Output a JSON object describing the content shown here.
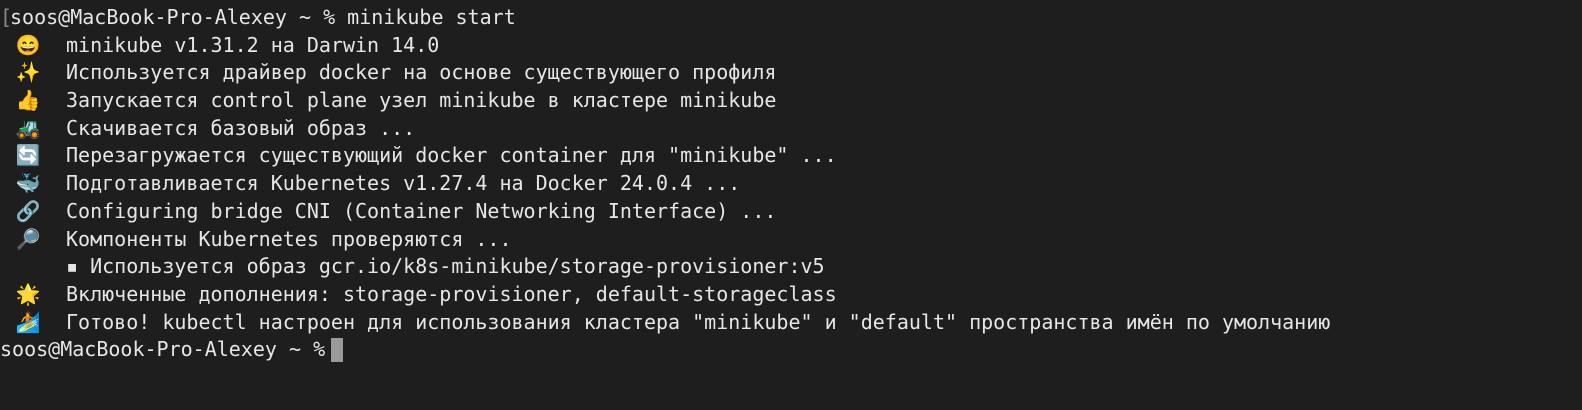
{
  "terminal": {
    "prompt": "soos@MacBook-Pro-Alexey ~ %",
    "command": "minikube start",
    "lines": [
      {
        "icon": "grinning-face-icon",
        "glyph": "😄",
        "text": "minikube v1.31.2 на Darwin 14.0"
      },
      {
        "icon": "sparkles-icon",
        "glyph": "✨",
        "text": "Используется драйвер docker на основе существующего профиля"
      },
      {
        "icon": "thumbs-up-icon",
        "glyph": "👍",
        "text": "Запускается control plane узел minikube в кластере minikube"
      },
      {
        "icon": "tractor-icon",
        "glyph": "🚜",
        "text": "Скачивается базовый образ ..."
      },
      {
        "icon": "arrows-refresh-icon",
        "glyph": "🔄",
        "text": "Перезагружается существующий docker container для \"minikube\" ..."
      },
      {
        "icon": "whale-icon",
        "glyph": "🐳",
        "text": "Подготавливается Kubernetes v1.27.4 на Docker 24.0.4 ..."
      },
      {
        "icon": "link-icon",
        "glyph": "🔗",
        "text": "Configuring bridge CNI (Container Networking Interface) ..."
      },
      {
        "icon": "magnifier-icon",
        "glyph": "🔎",
        "text": "Компоненты Kubernetes проверяются ..."
      },
      {
        "icon": "",
        "glyph": "",
        "text": "▪ Используется образ gcr.io/k8s-minikube/storage-provisioner:v5"
      },
      {
        "icon": "glowing-star-icon",
        "glyph": "🌟",
        "text": "Включенные дополнения: storage-provisioner, default-storageclass"
      },
      {
        "icon": "surfer-icon",
        "glyph": "🏄",
        "text": "Готово! kubectl настроен для использования кластера \"minikube\" и \"default\" пространства имён по умолчанию"
      }
    ],
    "final_prompt": "soos@MacBook-Pro-Alexey ~ %"
  }
}
